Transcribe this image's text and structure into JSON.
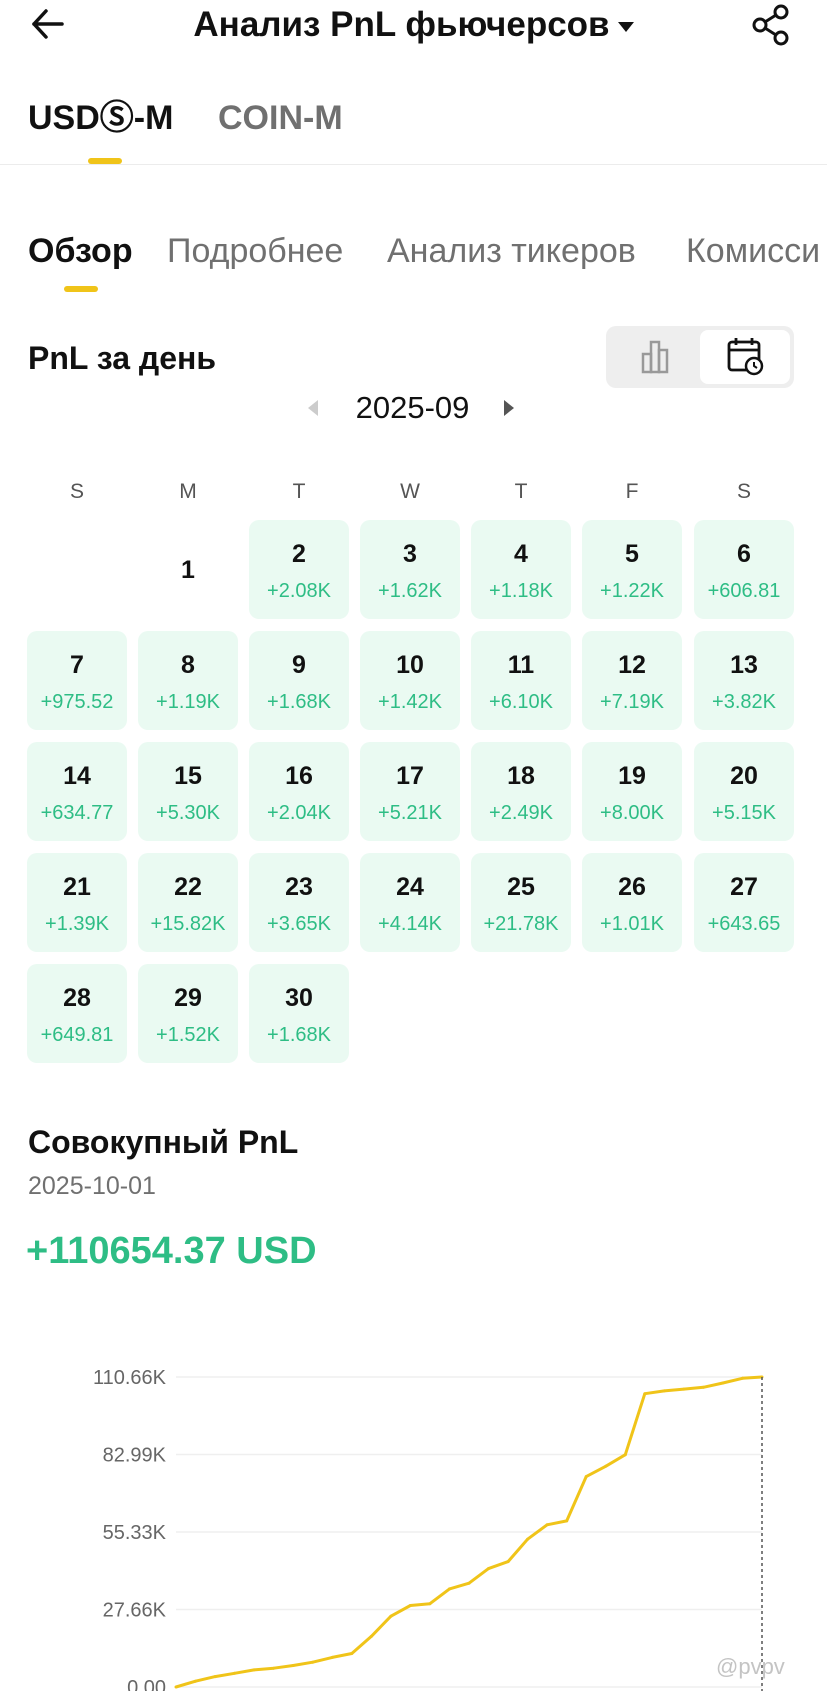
{
  "header": {
    "title": "Анализ PnL фьючерсов",
    "icons": {
      "back": "arrow-left-icon",
      "share": "share-icon",
      "dropdown": "caret-down-icon"
    }
  },
  "market_tabs": [
    {
      "label": "USDⓈ-M",
      "active": true
    },
    {
      "label": "COIN-M",
      "active": false
    }
  ],
  "sub_tabs": [
    {
      "label": "Обзор",
      "active": true
    },
    {
      "label": "Подробнее",
      "active": false
    },
    {
      "label": "Анализ тикеров",
      "active": false
    },
    {
      "label": "Комисси",
      "active": false
    }
  ],
  "daily_pnl": {
    "title": "PnL за день",
    "view_toggle": {
      "chart_icon": "bar-chart-icon",
      "calendar_icon": "calendar-clock-icon",
      "selected": "calendar"
    },
    "month": "2025-09",
    "weekdays": [
      "S",
      "M",
      "T",
      "W",
      "T",
      "F",
      "S"
    ],
    "days": [
      {
        "day": "1",
        "pnl": ""
      },
      {
        "day": "2",
        "pnl": "+2.08K"
      },
      {
        "day": "3",
        "pnl": "+1.62K"
      },
      {
        "day": "4",
        "pnl": "+1.18K"
      },
      {
        "day": "5",
        "pnl": "+1.22K"
      },
      {
        "day": "6",
        "pnl": "+606.81"
      },
      {
        "day": "7",
        "pnl": "+975.52"
      },
      {
        "day": "8",
        "pnl": "+1.19K"
      },
      {
        "day": "9",
        "pnl": "+1.68K"
      },
      {
        "day": "10",
        "pnl": "+1.42K"
      },
      {
        "day": "11",
        "pnl": "+6.10K"
      },
      {
        "day": "12",
        "pnl": "+7.19K"
      },
      {
        "day": "13",
        "pnl": "+3.82K"
      },
      {
        "day": "14",
        "pnl": "+634.77"
      },
      {
        "day": "15",
        "pnl": "+5.30K"
      },
      {
        "day": "16",
        "pnl": "+2.04K"
      },
      {
        "day": "17",
        "pnl": "+5.21K"
      },
      {
        "day": "18",
        "pnl": "+2.49K"
      },
      {
        "day": "19",
        "pnl": "+8.00K"
      },
      {
        "day": "20",
        "pnl": "+5.15K"
      },
      {
        "day": "21",
        "pnl": "+1.39K"
      },
      {
        "day": "22",
        "pnl": "+15.82K"
      },
      {
        "day": "23",
        "pnl": "+3.65K"
      },
      {
        "day": "24",
        "pnl": "+4.14K"
      },
      {
        "day": "25",
        "pnl": "+21.78K"
      },
      {
        "day": "26",
        "pnl": "+1.01K"
      },
      {
        "day": "27",
        "pnl": "+643.65"
      },
      {
        "day": "28",
        "pnl": "+649.81"
      },
      {
        "day": "29",
        "pnl": "+1.52K"
      },
      {
        "day": "30",
        "pnl": "+1.68K"
      }
    ]
  },
  "cumulative": {
    "title": "Совокупный PnL",
    "date": "2025-10-01",
    "value": "+110654.37 USD"
  },
  "chart_data": {
    "type": "line",
    "y_ticks": [
      "110.66K",
      "82.99K",
      "55.33K",
      "27.66K",
      "0.00"
    ],
    "ylim": [
      0,
      110.66
    ],
    "line_color": "#f0c419",
    "series": [
      {
        "values": [
          0,
          2.08,
          3.7,
          4.88,
          6.1,
          6.71,
          7.68,
          8.87,
          10.55,
          11.97,
          18.07,
          25.26,
          29.08,
          29.72,
          35.02,
          37.06,
          42.27,
          44.76,
          52.76,
          57.91,
          59.3,
          75.12,
          78.77,
          82.91,
          104.69,
          105.7,
          106.34,
          106.99,
          108.51,
          110.19,
          110.65
        ]
      }
    ]
  },
  "watermark": "@pvpv"
}
